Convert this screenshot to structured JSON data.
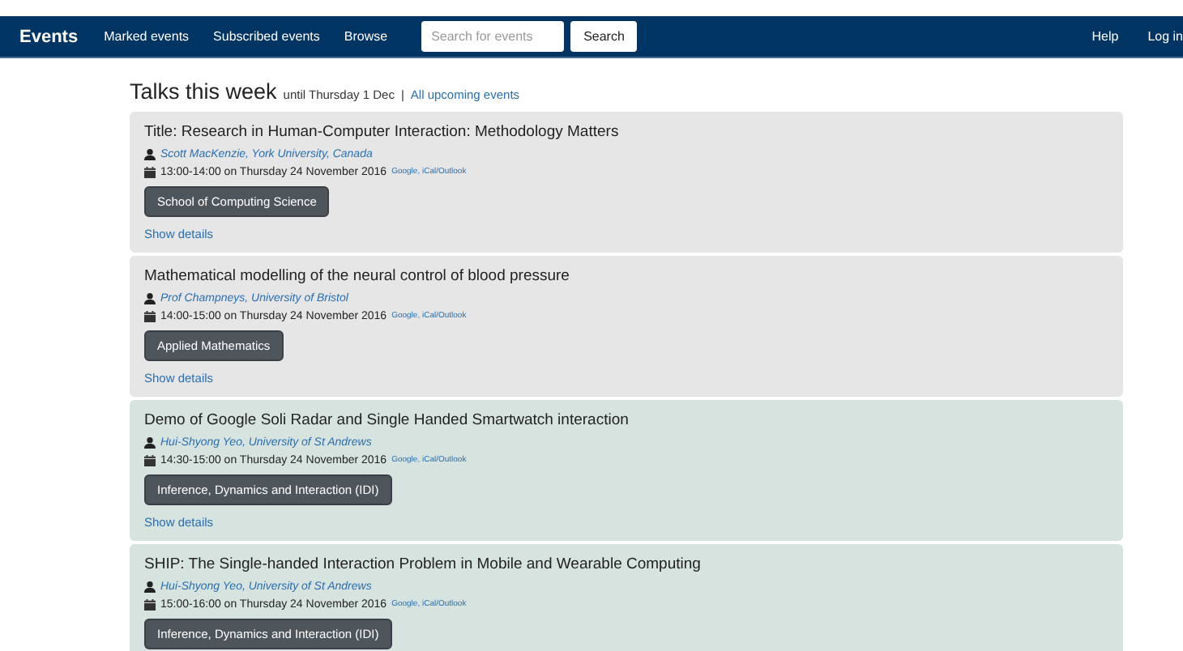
{
  "navbar": {
    "brand": "Events",
    "links": [
      "Marked events",
      "Subscribed events",
      "Browse"
    ],
    "search": {
      "placeholder": "Search for events",
      "button": "Search"
    },
    "right_links": [
      "Help",
      "Log in"
    ]
  },
  "heading": {
    "title": "Talks this week",
    "subtitle": "until Thursday 1 Dec",
    "separator": "|",
    "link": "All upcoming events"
  },
  "events": [
    {
      "title": "Title: Research in Human-Computer Interaction: Methodology Matters",
      "speaker": "Scott MacKenzie, York University, Canada",
      "when": "13:00-14:00 on Thursday 24 November 2016",
      "calendar_links": "Google, iCal/Outlook",
      "tag": "School of Computing Science",
      "show_details": "Show details",
      "color": "#e6e6e6"
    },
    {
      "title": "Mathematical modelling of the neural control of blood pressure",
      "speaker": "Prof Champneys, University of Bristol",
      "when": "14:00-15:00 on Thursday 24 November 2016",
      "calendar_links": "Google, iCal/Outlook",
      "tag": "Applied Mathematics",
      "show_details": "Show details",
      "color": "#e6e6e6"
    },
    {
      "title": "Demo of Google Soli Radar and Single Handed Smartwatch interaction",
      "speaker": "Hui-Shyong Yeo, University of St Andrews",
      "when": "14:30-15:00 on Thursday 24 November 2016",
      "calendar_links": "Google, iCal/Outlook",
      "tag": "Inference, Dynamics and Interaction (IDI)",
      "show_details": "Show details",
      "color": "#d6e3df"
    },
    {
      "title": "SHIP: The Single-handed Interaction Problem in Mobile and Wearable Computing",
      "speaker": "Hui-Shyong Yeo, University of St Andrews",
      "when": "15:00-16:00 on Thursday 24 November 2016",
      "calendar_links": "Google, iCal/Outlook",
      "tag": "Inference, Dynamics and Interaction (IDI)",
      "color": "#d6e3df"
    }
  ]
}
